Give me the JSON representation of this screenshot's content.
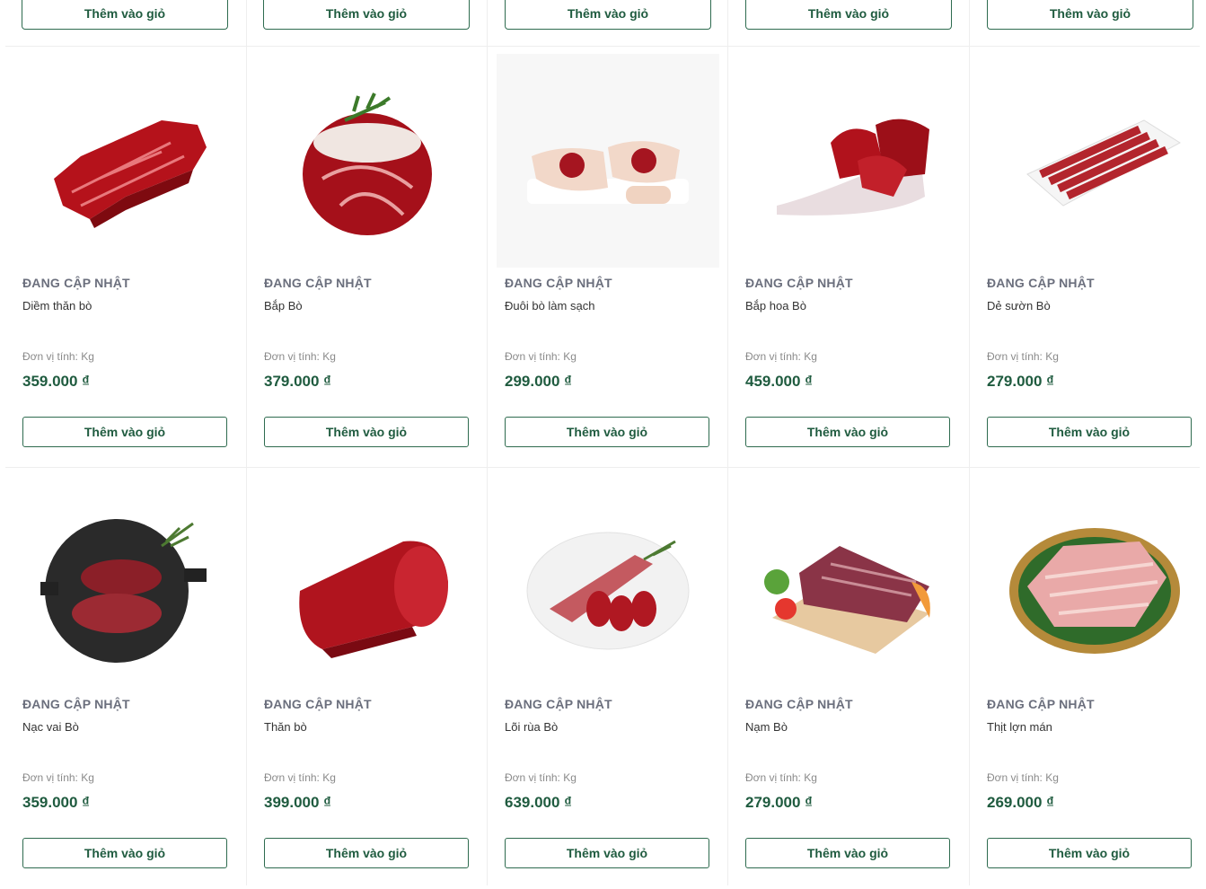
{
  "top_row": {
    "button_labels": [
      "Thêm vào giỏ",
      "Thêm vào giỏ",
      "Thêm vào giỏ",
      "Thêm vào giỏ",
      "Thêm vào giỏ"
    ]
  },
  "products": [
    {
      "brand": "ĐANG CẬP NHẬT",
      "name": "Diềm thăn bò",
      "unit": "Đơn vị tính: Kg",
      "price": "359.000 ₫",
      "button": "Thêm vào giỏ",
      "image": "beef-flank-cut"
    },
    {
      "brand": "ĐANG CẬP NHẬT",
      "name": "Bắp Bò",
      "unit": "Đơn vị tính: Kg",
      "price": "379.000 ₫",
      "button": "Thêm vào giỏ",
      "image": "beef-shank-with-rosemary"
    },
    {
      "brand": "ĐANG CẬP NHẬT",
      "name": "Đuôi bò làm sạch",
      "unit": "Đơn vị tính: Kg",
      "price": "299.000 ₫",
      "button": "Thêm vào giỏ",
      "image": "oxtail-pieces"
    },
    {
      "brand": "ĐANG CẬP NHẬT",
      "name": "Bắp hoa Bò",
      "unit": "Đơn vị tính: Kg",
      "price": "459.000 ₫",
      "button": "Thêm vào giỏ",
      "image": "beef-heel-muscle"
    },
    {
      "brand": "ĐANG CẬP NHẬT",
      "name": "Dẻ sườn Bò",
      "unit": "Đơn vị tính: Kg",
      "price": "279.000 ₫",
      "button": "Thêm vào giỏ",
      "image": "beef-rib-strips-tray"
    },
    {
      "brand": "ĐANG CẬP NHẬT",
      "name": "Nạc vai Bò",
      "unit": "Đơn vị tính: Kg",
      "price": "359.000 ₫",
      "button": "Thêm vào giỏ",
      "image": "beef-chuck-on-grill-pan"
    },
    {
      "brand": "ĐANG CẬP NHẬT",
      "name": "Thăn bò",
      "unit": "Đơn vị tính: Kg",
      "price": "399.000 ₫",
      "button": "Thêm vào giỏ",
      "image": "beef-tenderloin"
    },
    {
      "brand": "ĐANG CẬP NHẬT",
      "name": "Lõi rùa Bò",
      "unit": "Đơn vị tính: Kg",
      "price": "639.000 ₫",
      "button": "Thêm vào giỏ",
      "image": "beef-shin-slices-plate"
    },
    {
      "brand": "ĐANG CẬP NHẬT",
      "name": "Nạm Bò",
      "unit": "Đơn vị tính: Kg",
      "price": "279.000 ₫",
      "button": "Thêm vào giỏ",
      "image": "beef-brisket-board"
    },
    {
      "brand": "ĐANG CẬP NHẬT",
      "name": "Thịt lợn mán",
      "unit": "Đơn vị tính: Kg",
      "price": "269.000 ₫",
      "button": "Thêm vào giỏ",
      "image": "pork-on-woven-tray"
    }
  ]
}
